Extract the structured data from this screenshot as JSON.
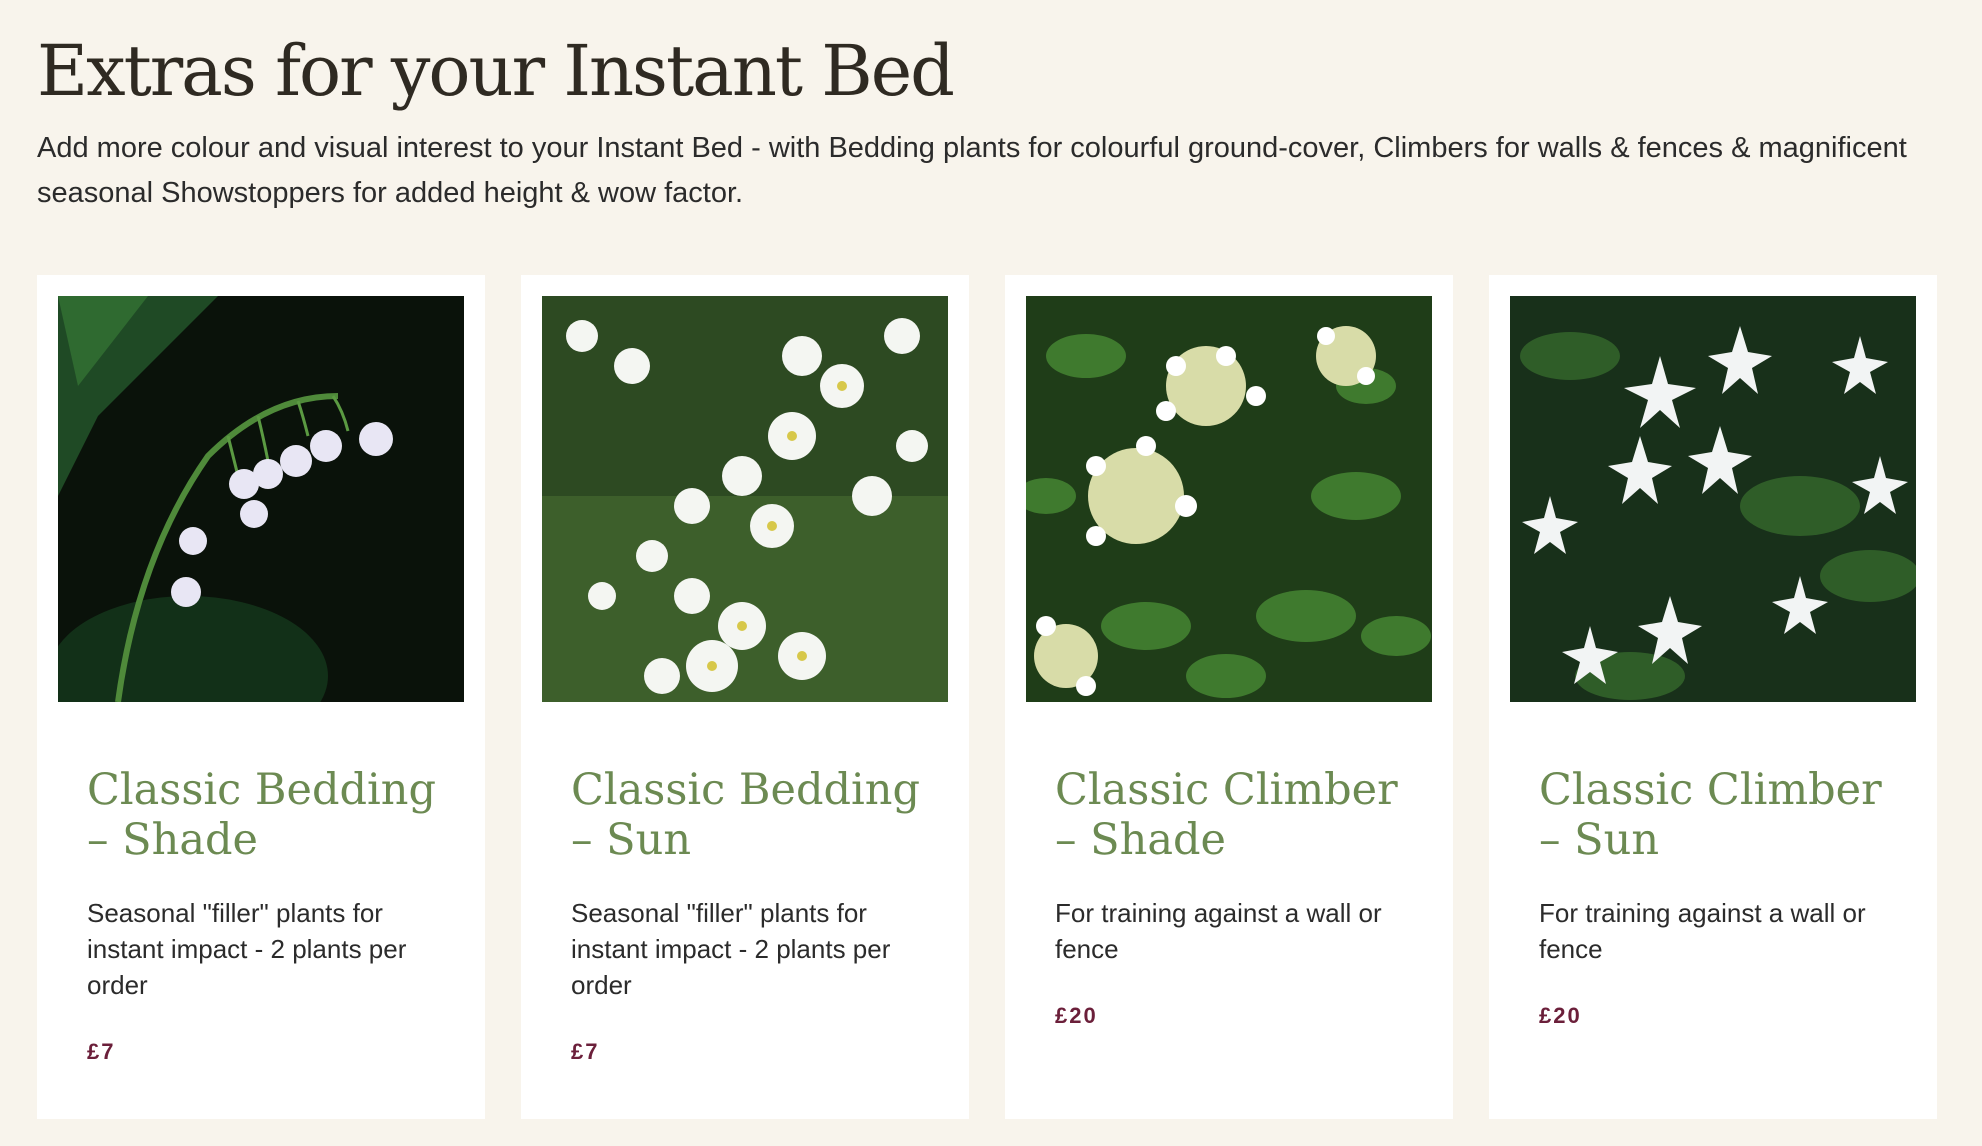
{
  "section": {
    "title": "Extras for your Instant Bed",
    "intro": "Add more colour and visual interest to your Instant Bed - with Bedding plants for colourful ground-cover, Climbers for walls & fences & magnificent seasonal Showstoppers for added height & wow factor."
  },
  "cards": [
    {
      "title_line1": "Classic Bedding",
      "title_line2": "– Shade",
      "description": "Seasonal \"filler\" plants for instant impact - 2 plants per order",
      "price": "£7",
      "image_icon": "lily-of-the-valley-photo"
    },
    {
      "title_line1": "Classic Bedding",
      "title_line2": "– Sun",
      "description": "Seasonal \"filler\" plants for instant impact - 2 plants per order",
      "price": "£7",
      "image_icon": "white-bedding-flowers-photo"
    },
    {
      "title_line1": "Classic Climber",
      "title_line2": "– Shade",
      "description": "For training against a wall or fence",
      "price": "£20",
      "image_icon": "climbing-hydrangea-photo"
    },
    {
      "title_line1": "Classic Climber",
      "title_line2": "– Sun",
      "description": "For training against a wall or fence",
      "price": "£20",
      "image_icon": "star-jasmine-photo"
    }
  ],
  "colors": {
    "background": "#f8f4ec",
    "card": "#ffffff",
    "title_green": "#6c8a52",
    "price": "#6b1f3a",
    "heading": "#2f2a22"
  }
}
